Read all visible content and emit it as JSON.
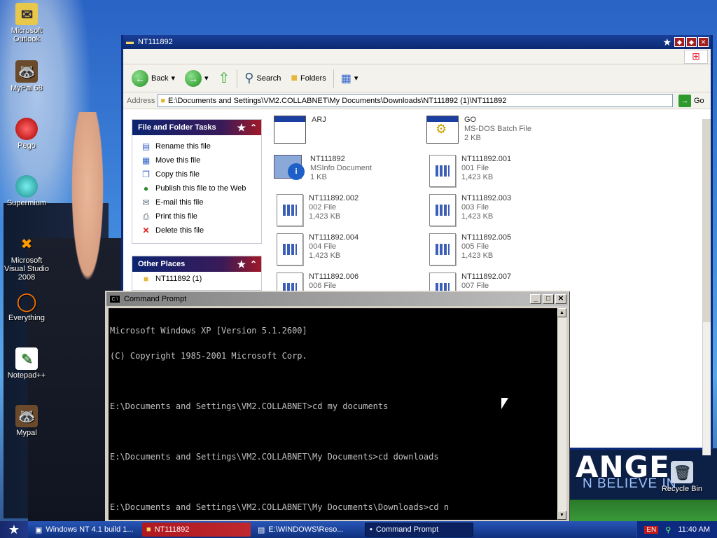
{
  "desktop": {
    "icons": [
      {
        "label": "Microsoft Outlook",
        "icon": "outlook-icon"
      },
      {
        "label": "MyPal 68",
        "icon": "mypal-icon"
      },
      {
        "label": "Pego",
        "icon": "pego-icon"
      },
      {
        "label": "Supermium",
        "icon": "supermium-icon"
      },
      {
        "label": "Microsoft Visual Studio 2008",
        "icon": "visual-studio-icon"
      },
      {
        "label": "Everything",
        "icon": "everything-icon"
      },
      {
        "label": "Notepad++",
        "icon": "notepadpp-icon"
      },
      {
        "label": "Mypal",
        "icon": "mypal-icon"
      }
    ],
    "recycle_bin": "Recycle Bin",
    "wallpaper_text": {
      "big": "ANGE",
      "small": "N BELIEVE IN"
    }
  },
  "explorer": {
    "title": "NT111892",
    "toolbar": {
      "back": "Back",
      "search": "Search",
      "folders": "Folders"
    },
    "address_label": "Address",
    "address_value": "E:\\Documents and Settings\\VM2.COLLABNET\\My Documents\\Downloads\\NT111892 (1)\\NT111892",
    "go": "Go",
    "tasks_panel": {
      "title": "File and Folder Tasks",
      "items": [
        {
          "label": "Rename this file",
          "icon": "rename-icon"
        },
        {
          "label": "Move this file",
          "icon": "move-icon"
        },
        {
          "label": "Copy this file",
          "icon": "copy-icon"
        },
        {
          "label": "Publish this file to the Web",
          "icon": "globe-icon"
        },
        {
          "label": "E-mail this file",
          "icon": "email-icon"
        },
        {
          "label": "Print this file",
          "icon": "print-icon"
        },
        {
          "label": "Delete this file",
          "icon": "delete-icon"
        }
      ]
    },
    "places_panel": {
      "title": "Other Places",
      "items": [
        {
          "label": "NT111892 (1)",
          "icon": "folder-icon"
        }
      ]
    },
    "files": [
      {
        "name": "ARJ",
        "type": "",
        "size": ""
      },
      {
        "name": "GO",
        "type": "MS-DOS Batch File",
        "size": "2 KB"
      },
      {
        "name": "NT111892",
        "type": "MSInfo Document",
        "size": "1 KB"
      },
      {
        "name": "NT111892.001",
        "type": "001 File",
        "size": "1,423 KB"
      },
      {
        "name": "NT111892.002",
        "type": "002 File",
        "size": "1,423 KB"
      },
      {
        "name": "NT111892.003",
        "type": "003 File",
        "size": "1,423 KB"
      },
      {
        "name": "NT111892.004",
        "type": "004 File",
        "size": "1,423 KB"
      },
      {
        "name": "NT111892.005",
        "type": "005 File",
        "size": "1,423 KB"
      },
      {
        "name": "NT111892.006",
        "type": "006 File",
        "size": ""
      },
      {
        "name": "NT111892.007",
        "type": "007 File",
        "size": ""
      }
    ]
  },
  "cmd": {
    "title": "Command Prompt",
    "lines": [
      "Microsoft Windows XP [Version 5.1.2600]",
      "(C) Copyright 1985-2001 Microsoft Corp.",
      "",
      "E:\\Documents and Settings\\VM2.COLLABNET>cd my documents",
      "",
      "E:\\Documents and Settings\\VM2.COLLABNET\\My Documents>cd downloads",
      "",
      "E:\\Documents and Settings\\VM2.COLLABNET\\My Documents\\Downloads>cd n"
    ]
  },
  "taskbar": {
    "items": [
      {
        "label": "Windows NT 4.1 build 1...",
        "style": "plain"
      },
      {
        "label": "NT111892",
        "style": "red"
      },
      {
        "label": "E:\\WINDOWS\\Reso...",
        "style": "plain"
      },
      {
        "label": "Command Prompt",
        "style": "active"
      }
    ],
    "lang": "EN",
    "clock": "11:40 AM"
  }
}
